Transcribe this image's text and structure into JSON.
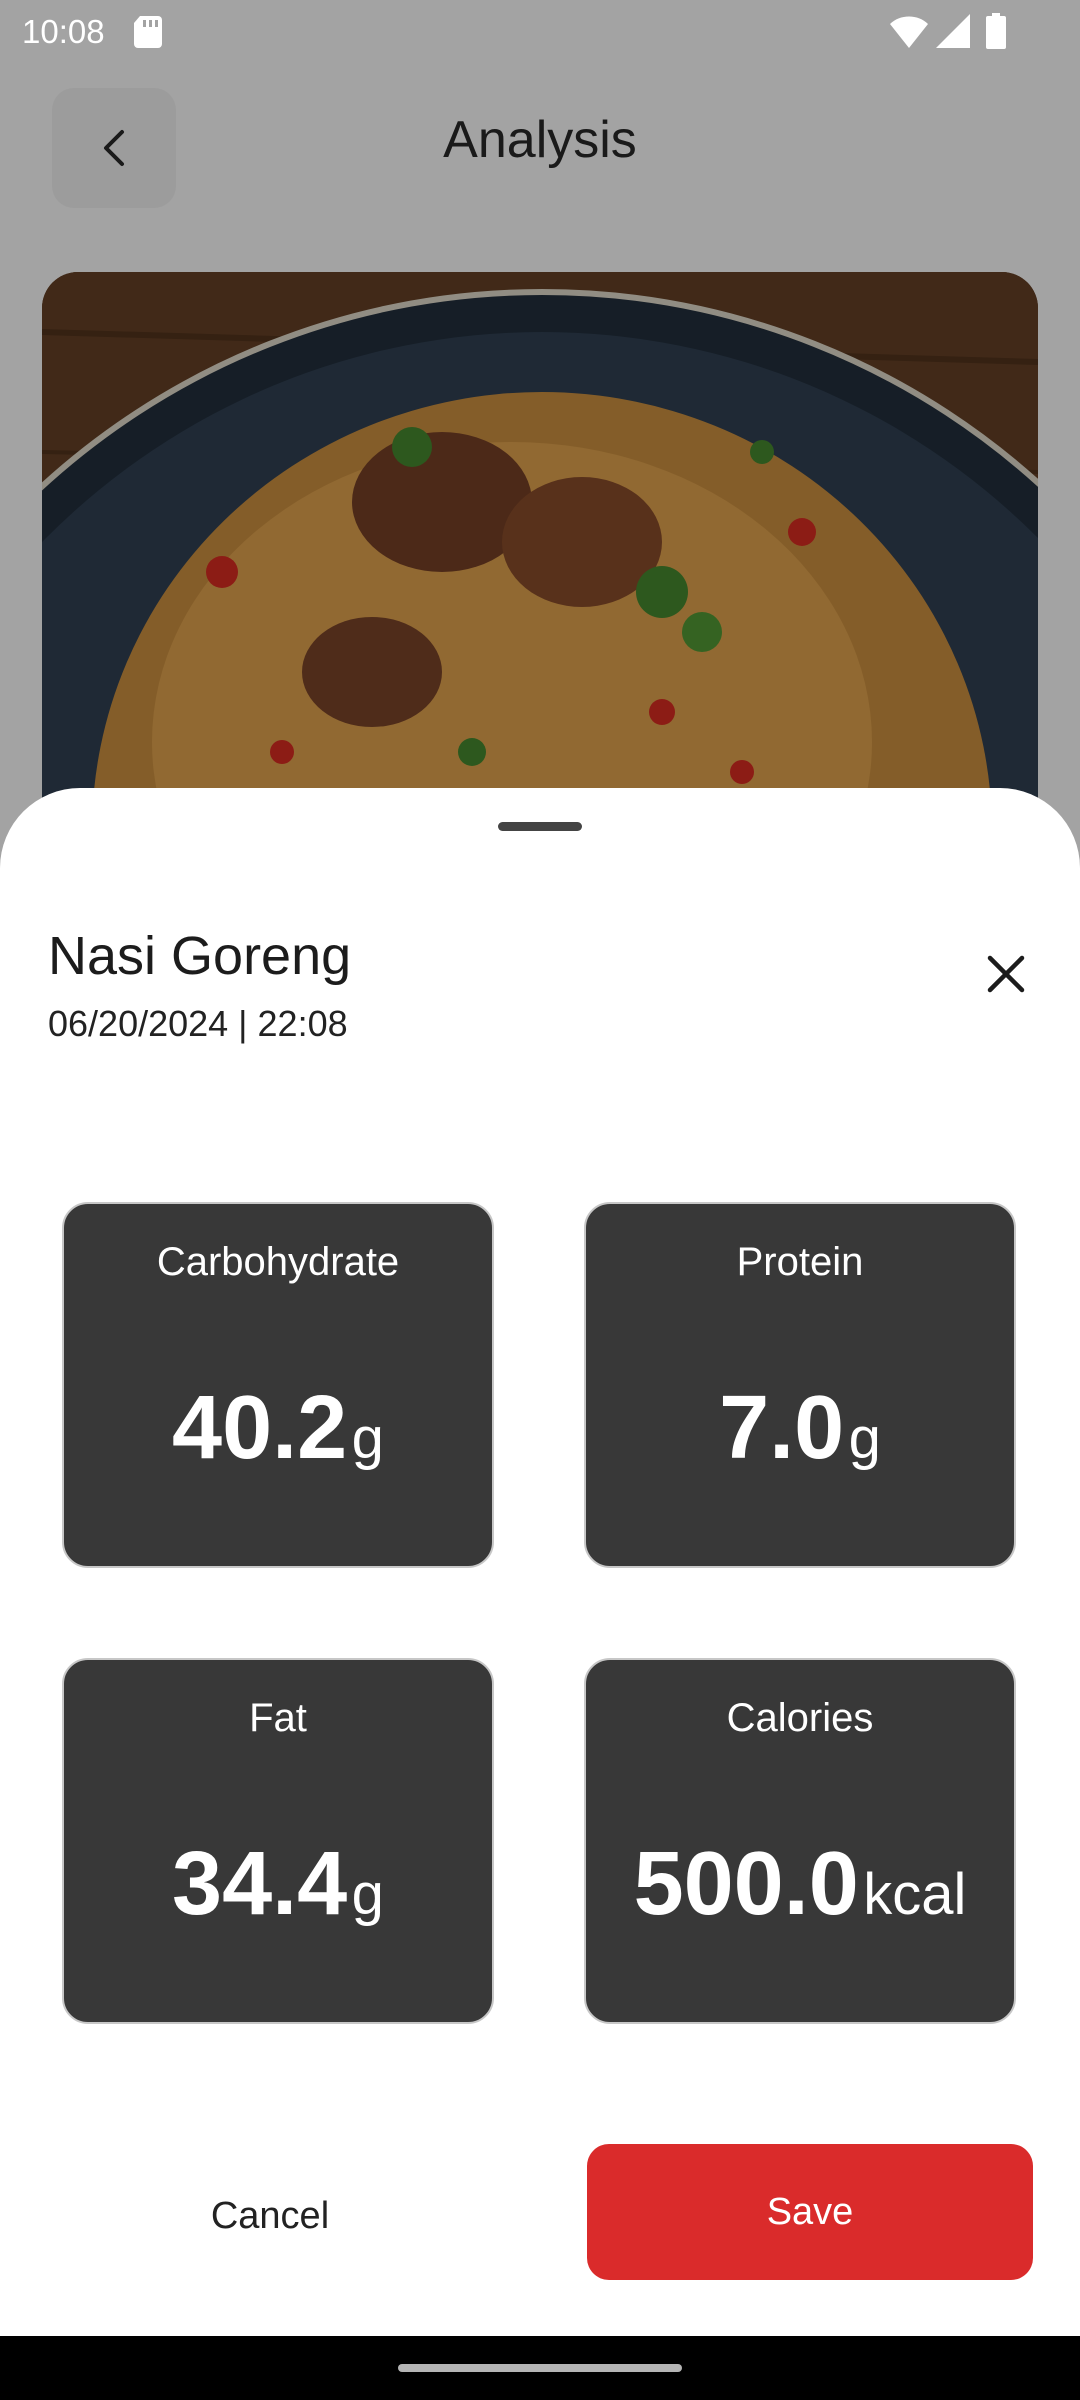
{
  "status_bar": {
    "time": "10:08",
    "icons": [
      "sd-card-icon",
      "wifi-icon",
      "signal-icon",
      "battery-icon"
    ]
  },
  "app_bar": {
    "back_icon": "chevron-left-icon",
    "title": "Analysis"
  },
  "sheet": {
    "food_name": "Nasi Goreng",
    "datetime": "06/20/2024 | 22:08",
    "close_icon": "close-icon",
    "nutrients": [
      {
        "label": "Carbohydrate",
        "value": "40.2",
        "unit": "g"
      },
      {
        "label": "Protein",
        "value": "7.0",
        "unit": "g"
      },
      {
        "label": "Fat",
        "value": "34.4",
        "unit": "g"
      },
      {
        "label": "Calories",
        "value": "500.0",
        "unit": "kcal"
      }
    ],
    "cancel_label": "Cancel",
    "save_label": "Save"
  },
  "colors": {
    "accent": "#da2b2b",
    "card_background": "#383838",
    "scrim": "#a3a3a3"
  }
}
